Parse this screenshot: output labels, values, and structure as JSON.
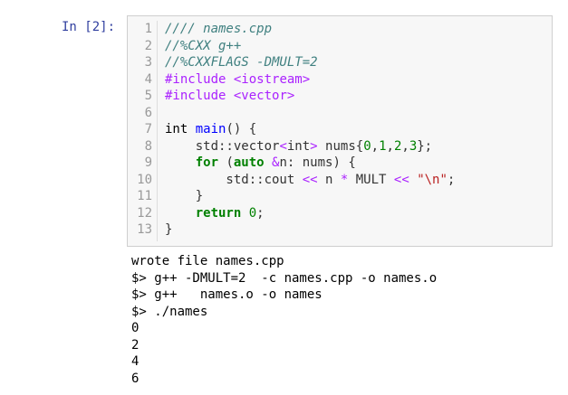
{
  "prompt": "In [2]:",
  "line_numbers": [
    "1",
    "2",
    "3",
    "4",
    "5",
    "6",
    "7",
    "8",
    "9",
    "10",
    "11",
    "12",
    "13"
  ],
  "code": {
    "l1": "//// names.cpp",
    "l2": "//%CXX g++",
    "l3": "//%CXXFLAGS -DMULT=2",
    "l4_dir": "#include",
    "l4_arg": " <iostream>",
    "l5_dir": "#include",
    "l5_arg": " <vector>",
    "l7_a": "int ",
    "l7_fn": "main",
    "l7_b": "() {",
    "l8_a": "    std::vector",
    "l8_lt": "<",
    "l8_int": "int",
    "l8_gt": ">",
    "l8_b": " nums{",
    "l8_n0": "0",
    "l8_c1": ",",
    "l8_n1": "1",
    "l8_c2": ",",
    "l8_n2": "2",
    "l8_c3": ",",
    "l8_n3": "3",
    "l8_end": "};",
    "l9_ind": "    ",
    "l9_for": "for",
    "l9_a": " (",
    "l9_auto": "auto",
    "l9_sp": " ",
    "l9_amp": "&",
    "l9_b": "n: nums) {",
    "l10_a": "        std::cout ",
    "l10_op1": "<<",
    "l10_b": " n ",
    "l10_star": "*",
    "l10_c": " MULT ",
    "l10_op2": "<<",
    "l10_sp": " ",
    "l10_str": "\"\\n\"",
    "l10_end": ";",
    "l11": "    }",
    "l12_ind": "    ",
    "l12_ret": "return",
    "l12_sp": " ",
    "l12_zero": "0",
    "l12_end": ";",
    "l13": "}"
  },
  "output_lines": [
    "wrote file names.cpp",
    "$> g++ -DMULT=2  -c names.cpp -o names.o",
    "$> g++   names.o -o names",
    "$> ./names",
    "0",
    "2",
    "4",
    "6"
  ]
}
